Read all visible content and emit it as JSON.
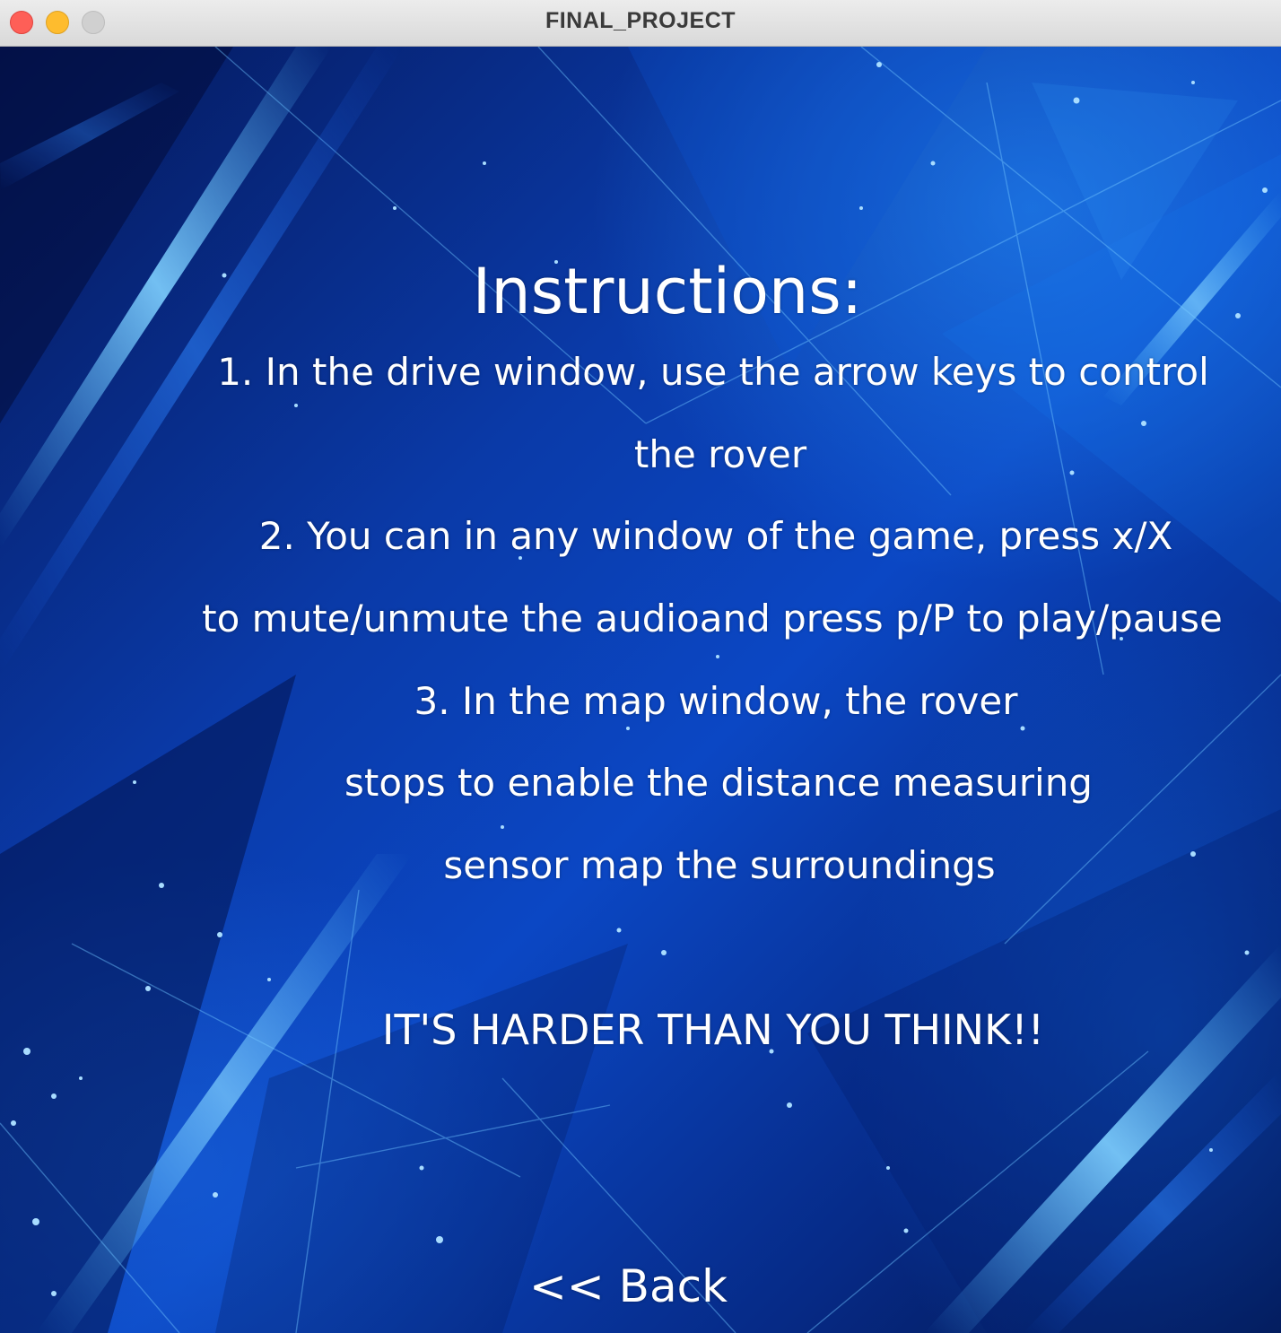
{
  "window": {
    "title": "FINAL_PROJECT"
  },
  "instructions": {
    "heading": "Instructions:",
    "lines": [
      "1. In the drive window, use the arrow keys to control",
      "the rover",
      "2. You can in any window of the game, press x/X",
      "to mute/unmute the audioand press p/P to play/pause",
      "3. In the map window, the rover",
      "stops to enable the distance measuring",
      "sensor map the surroundings"
    ],
    "warning": "IT'S HARDER THAN YOU THINK!!"
  },
  "navigation": {
    "back_label": "<< Back"
  },
  "colors": {
    "text": "#ffffff",
    "background_primary": "#0b47c4",
    "background_dark": "#031448",
    "glow": "#4fb6ff"
  }
}
